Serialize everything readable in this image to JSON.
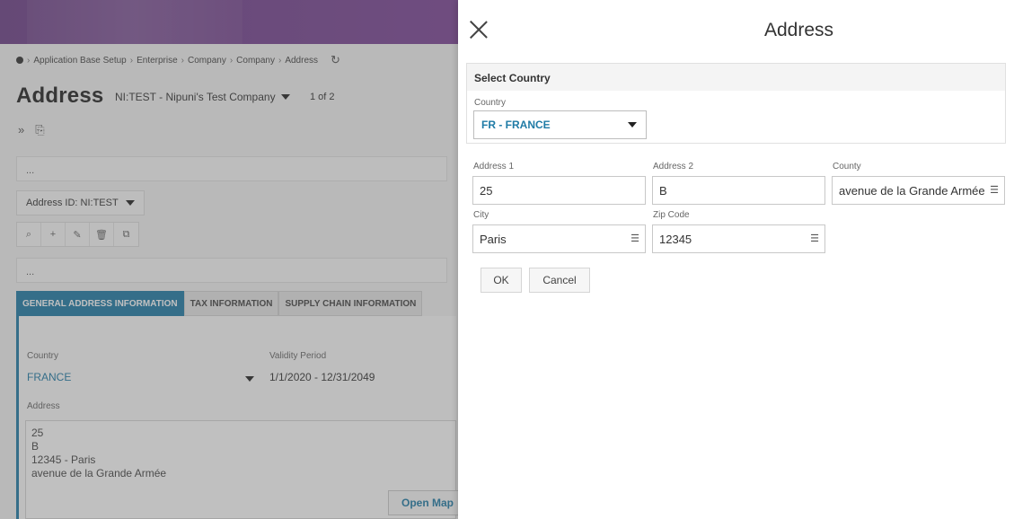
{
  "breadcrumb": {
    "items": [
      "Application Base Setup",
      "Enterprise",
      "Company",
      "Company",
      "Address"
    ]
  },
  "page": {
    "title": "Address",
    "record": "NI:TEST - Nipuni's Test Company",
    "record_count": "1 of 2",
    "ellipsis": "...",
    "address_id": "Address ID: NI:TEST"
  },
  "tabs": [
    {
      "label": "GENERAL ADDRESS INFORMATION"
    },
    {
      "label": "TAX INFORMATION"
    },
    {
      "label": "SUPPLY CHAIN INFORMATION"
    }
  ],
  "general": {
    "country_label": "Country",
    "country_value": "FRANCE",
    "validity_label": "Validity Period",
    "validity_value": "1/1/2020 - 12/31/2049",
    "address_label": "Address",
    "address_lines": [
      "25",
      "B",
      "12345 - Paris",
      "avenue de la Grande Armée"
    ],
    "open_map": "Open Map"
  },
  "dialog": {
    "title": "Address",
    "section_title": "Select Country",
    "country_label": "Country",
    "country_value": "FR - FRANCE",
    "fields": {
      "address1": {
        "label": "Address 1",
        "value": "25"
      },
      "address2": {
        "label": "Address 2",
        "value": "B"
      },
      "county": {
        "label": "County",
        "value": "avenue de la Grande Armée"
      },
      "city": {
        "label": "City",
        "value": "Paris"
      },
      "zip": {
        "label": "Zip Code",
        "value": "12345"
      }
    },
    "ok_label": "OK",
    "cancel_label": "Cancel"
  },
  "colors": {
    "accent": "#1f7ba6",
    "header": "#7b4596"
  }
}
